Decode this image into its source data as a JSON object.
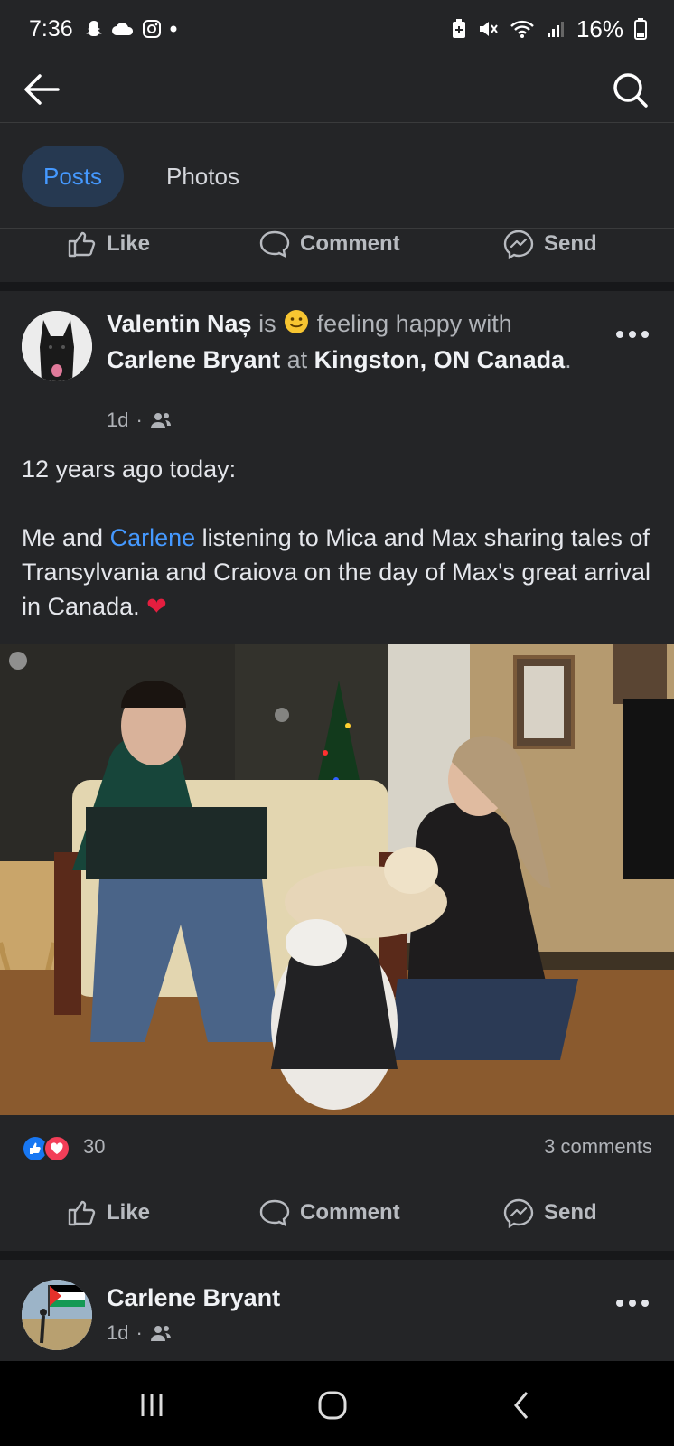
{
  "status_bar": {
    "time": "7:36",
    "battery": "16%",
    "left_icons": [
      "snapchat-icon",
      "cloud-icon",
      "instagram-icon",
      "dot-icon"
    ],
    "right_icons": [
      "battery-saver-icon",
      "mute-icon",
      "wifi-icon",
      "signal-icon",
      "battery-icon"
    ]
  },
  "tabs": [
    {
      "label": "Posts",
      "active": true
    },
    {
      "label": "Photos",
      "active": false
    }
  ],
  "actions": {
    "like": "Like",
    "comment": "Comment",
    "send": "Send"
  },
  "post": {
    "author": "Valentin Naș",
    "is_text": "is",
    "feeling_text": "feeling happy with",
    "with_name": "Carlene Bryant",
    "at_text": "at",
    "location": "Kingston, ON Canada",
    "period": ".",
    "time": "1d",
    "dot": "·",
    "body_line1": "12 years ago today:",
    "body_pre": "Me and",
    "body_mention": "Carlene",
    "body_post": "listening to Mica and Max sharing tales of Transylvania and Craiova on the day of Max's great arrival in Canada.",
    "heart": "❤",
    "reaction_count": "30",
    "comments": "3 comments"
  },
  "next_post": {
    "author": "Carlene Bryant",
    "time": "1d",
    "dot": "·"
  },
  "colors": {
    "background": "#242527",
    "accent": "#4599ff",
    "heart": "#e41e3f"
  }
}
